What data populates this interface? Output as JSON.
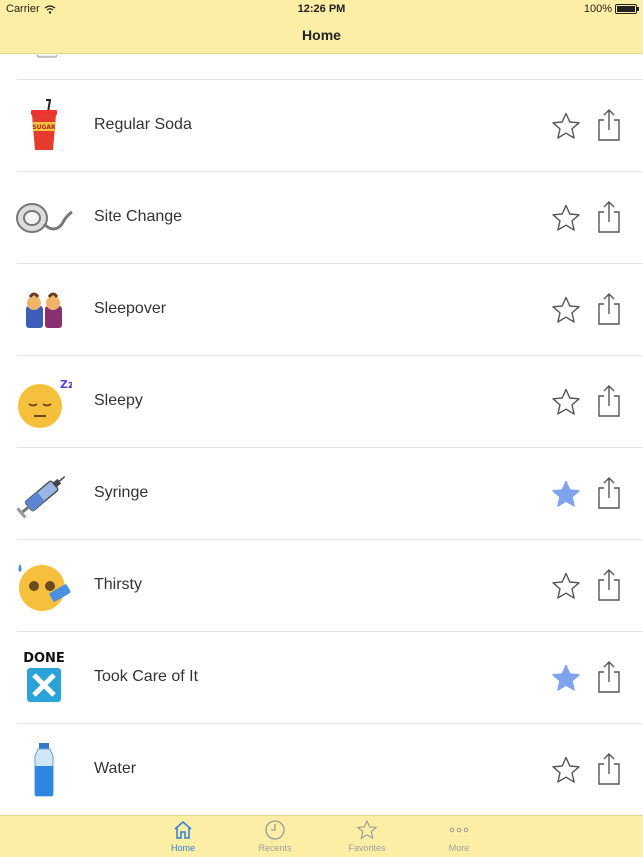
{
  "status_bar": {
    "carrier": "Carrier",
    "time": "12:26 PM",
    "battery": "100%"
  },
  "nav": {
    "title": "Home"
  },
  "items": [
    {
      "label": "Regular Soda",
      "icon": "soda-cup-icon",
      "icon_text": "SUGAR",
      "favorite": false
    },
    {
      "label": "Site Change",
      "icon": "infusion-site-icon",
      "favorite": false
    },
    {
      "label": "Sleepover",
      "icon": "sleepover-icon",
      "favorite": false
    },
    {
      "label": "Sleepy",
      "icon": "sleepy-face-icon",
      "icon_text": "Zz",
      "favorite": false
    },
    {
      "label": "Syringe",
      "icon": "syringe-icon",
      "favorite": true
    },
    {
      "label": "Thirsty",
      "icon": "thirsty-face-icon",
      "favorite": false
    },
    {
      "label": "Took Care of It",
      "icon": "done-check-icon",
      "icon_text": "DONE",
      "favorite": true
    },
    {
      "label": "Water",
      "icon": "water-bottle-icon",
      "favorite": false
    }
  ],
  "tabs": [
    {
      "label": "Home",
      "icon": "home-icon",
      "active": true
    },
    {
      "label": "Recents",
      "icon": "clock-icon",
      "active": false
    },
    {
      "label": "Favorites",
      "icon": "star-icon",
      "active": false
    },
    {
      "label": "More",
      "icon": "more-dots-icon",
      "active": false
    }
  ],
  "colors": {
    "header_bg": "#fdeea6",
    "accent": "#2f7fd8",
    "favorite_star": "#7fa3ef"
  }
}
